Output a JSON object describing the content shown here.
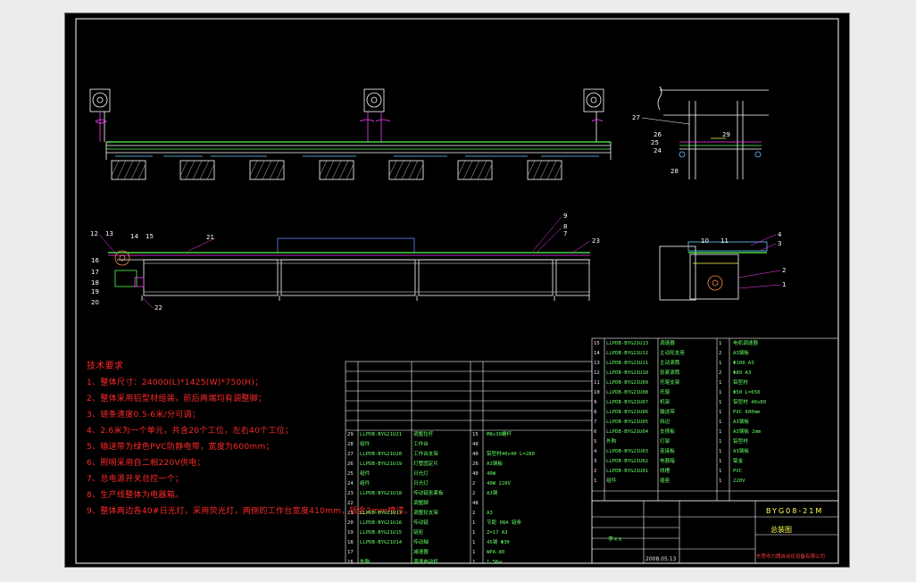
{
  "notes": {
    "title": "技术要求",
    "items": [
      "1、整体尺寸：24000(L)*1425(W)*750(H)；",
      "2、整体采用铝型材组装，前后两端均有调整脚；",
      "3、链条速度0.5-6米/分可调；",
      "4、2.6米为一个单元，共含20个工位，左右40个工位；",
      "5、输送带为绿色PVC防静电带，宽度为600mm；",
      "6、照明采用自二相220V供电；",
      "7、总电源开关总控一个；",
      "8、生产线整体为电器箱。",
      "9、整体两边各40#日光灯，采用荧光灯，两侧的工作台宽度410mm，钣金2mm喷漆。"
    ]
  },
  "bom_left": [
    {
      "no": "29",
      "code": "LLPDB-BYG21U21",
      "name": "调整拉杆",
      "qty": "15",
      "spec": "M8x30螺杆"
    },
    {
      "no": "28",
      "code": "组件",
      "name": "工作台",
      "qty": "40",
      "spec": ""
    },
    {
      "no": "27",
      "code": "LLPDB-BYG21U20",
      "name": "工作台支架",
      "qty": "40",
      "spec": "铝型材40x40 L=280"
    },
    {
      "no": "26",
      "code": "LLPDB-BYG21U19",
      "name": "灯管固定片",
      "qty": "26",
      "spec": "A3钢板"
    },
    {
      "no": "25",
      "code": "组件",
      "name": "日光灯",
      "qty": "40",
      "spec": "40W"
    },
    {
      "no": "24",
      "code": "组件",
      "name": "日光灯",
      "qty": "2",
      "spec": "40W 220V"
    },
    {
      "no": "23",
      "code": "LLPDB-BYG21U18",
      "name": "传动链张紧板",
      "qty": "2",
      "spec": "A3钢"
    },
    {
      "no": "22",
      "code": "",
      "name": "调整脚",
      "qty": "48",
      "spec": ""
    },
    {
      "no": "21",
      "code": "LLPDB-BYG21U17",
      "name": "调整轮支架",
      "qty": "2",
      "spec": "A3"
    },
    {
      "no": "20",
      "code": "LLPDB-BYG21U16",
      "name": "传动链",
      "qty": "1",
      "spec": "节距 08A 链条"
    },
    {
      "no": "19",
      "code": "LLPDB-BYG21U15",
      "name": "链轮",
      "qty": "1",
      "spec": "Z=17 A3"
    },
    {
      "no": "18",
      "code": "LLPDB-BYG21U14",
      "name": "传动轴",
      "qty": "1",
      "spec": "45钢 Φ30"
    },
    {
      "no": "17",
      "code": "",
      "name": "减速器",
      "qty": "1",
      "spec": "WPA-80"
    },
    {
      "no": "16",
      "code": "外购",
      "name": "调速电动机",
      "qty": "1",
      "spec": "1.5Kw"
    }
  ],
  "bom_right": [
    {
      "no": "15",
      "code": "LLPDB-BYG21U13",
      "name": "调速器",
      "qty": "1",
      "spec": "电机调速器"
    },
    {
      "no": "14",
      "code": "LLPDB-BYG21U12",
      "name": "主动轮支座",
      "qty": "2",
      "spec": "A3钢板"
    },
    {
      "no": "13",
      "code": "LLPDB-BYG21U11",
      "name": "主动滚筒",
      "qty": "1",
      "spec": "Φ108 A3"
    },
    {
      "no": "12",
      "code": "LLPDB-BYG21U10",
      "name": "张紧滚筒",
      "qty": "2",
      "spec": "Φ89 A3"
    },
    {
      "no": "11",
      "code": "LLPDB-BYG21U09",
      "name": "托辊支架",
      "qty": "1",
      "spec": "铝型材"
    },
    {
      "no": "10",
      "code": "LLPDB-BYG21U08",
      "name": "托辊",
      "qty": "1",
      "spec": "Φ50 L=650"
    },
    {
      "no": "9",
      "code": "LLPDB-BYG21U07",
      "name": "机架",
      "qty": "1",
      "spec": "铝型材 40x80"
    },
    {
      "no": "8",
      "code": "LLPDB-BYG21U06",
      "name": "输送带",
      "qty": "1",
      "spec": "PVC 600mm"
    },
    {
      "no": "7",
      "code": "LLPDB-BYG21U05",
      "name": "挡边",
      "qty": "1",
      "spec": "A3钢板"
    },
    {
      "no": "6",
      "code": "LLPDB-BYG21U04",
      "name": "支撑板",
      "qty": "1",
      "spec": "A3钢板 2mm"
    },
    {
      "no": "5",
      "code": "外购",
      "name": "灯架",
      "qty": "1",
      "spec": "铝型材"
    },
    {
      "no": "4",
      "code": "LLPDB-BYG21U03",
      "name": "连接板",
      "qty": "1",
      "spec": "A3钢板"
    },
    {
      "no": "3",
      "code": "LLPDB-BYG21U02",
      "name": "电器箱",
      "qty": "1",
      "spec": "钣金"
    },
    {
      "no": "2",
      "code": "LLPDB-BYG21U01",
      "name": "线槽",
      "qty": "1",
      "spec": "PVC"
    },
    {
      "no": "1",
      "code": "组件",
      "name": "插座",
      "qty": "1",
      "spec": "220V"
    }
  ],
  "title_block": {
    "drawing_no": "BYG08-21M",
    "name": "总装图",
    "company": "东莞市力朗自动化设备有限公司",
    "date": "2008.05.13",
    "author": "李××"
  },
  "colors": {
    "background": "#000000",
    "frame": "#ffffff",
    "notes": "#ff2a2a",
    "leaders": "#ff3cff",
    "belt": "#55ff55"
  }
}
